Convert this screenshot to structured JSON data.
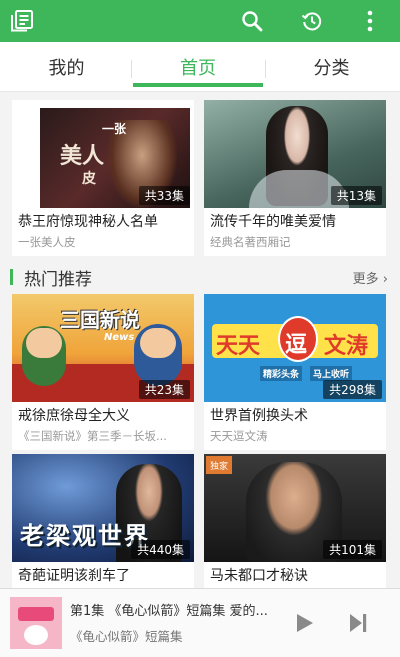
{
  "colors": {
    "accent": "#3eb75b",
    "bar_bg": "#3eb75b"
  },
  "appbar": {
    "icons": [
      "notes-icon",
      "search-icon",
      "history-icon",
      "more-vertical-icon"
    ]
  },
  "tabs": [
    {
      "label": "我的",
      "active": false
    },
    {
      "label": "首页",
      "active": true
    },
    {
      "label": "分类",
      "active": false
    }
  ],
  "top_cards": [
    {
      "title": "恭王府惊现神秘人名单",
      "subtitle": "一张美人皮",
      "episodes": "共33集",
      "cover_text": [
        "一张",
        "美人",
        "皮"
      ]
    },
    {
      "title": "流传千年的唯美爱情",
      "subtitle": "经典名著西厢记",
      "episodes": "共13集"
    }
  ],
  "section": {
    "title": "热门推荐",
    "more": "更多"
  },
  "recommend_cards": [
    {
      "title": "戒徐庶徐母全大义",
      "subtitle": "《三国新说》第三季－长坂...",
      "episodes": "共23集",
      "cover_text": "三国新说",
      "cover_sub": "News"
    },
    {
      "title": "世界首例换头术",
      "subtitle": "天天逗文涛",
      "episodes": "共298集",
      "cover_text": [
        "天天",
        "逗",
        "文涛"
      ],
      "cover_sub": [
        "精彩头条",
        "马上收听"
      ]
    },
    {
      "title": "奇葩证明该刹车了",
      "subtitle": "",
      "episodes": "共440集",
      "cover_text": "老梁观世界"
    },
    {
      "title": "马未都口才秘诀",
      "subtitle": "",
      "episodes": "共101集",
      "cover_badge": "独家"
    }
  ],
  "player": {
    "title": "第1集 《龟心似箭》短篇集 爱的...",
    "subtitle": "《龟心似箭》短篇集"
  }
}
